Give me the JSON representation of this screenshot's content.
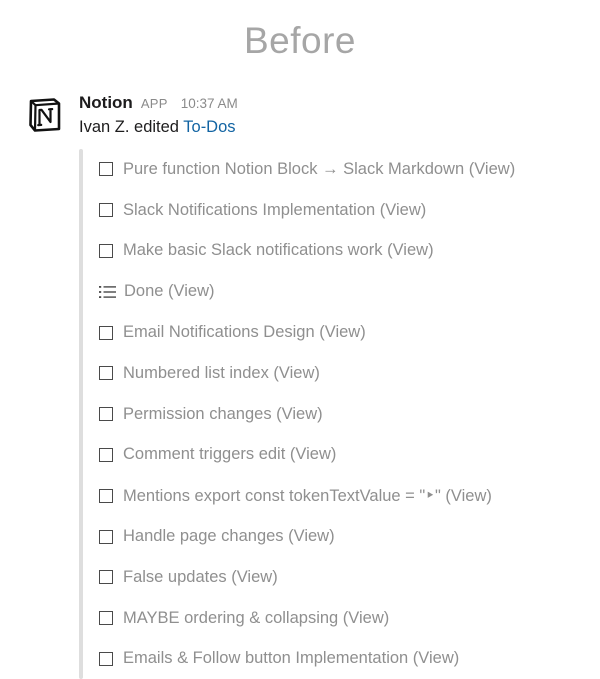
{
  "heading": "Before",
  "message": {
    "sender": "Notion",
    "badge": "APP",
    "time": "10:37 AM",
    "summary_prefix": "Ivan Z. edited ",
    "summary_link": "To-Dos"
  },
  "items": [
    {
      "icon": "checkbox-icon",
      "text": "Pure function Notion Block → Slack Markdown (View)"
    },
    {
      "icon": "checkbox-icon",
      "text": "Slack Notifications Implementation (View)"
    },
    {
      "icon": "checkbox-icon",
      "text": "Make basic Slack notifications work (View)"
    },
    {
      "icon": "list-icon",
      "text": "Done (View)"
    },
    {
      "icon": "checkbox-icon",
      "text": "Email Notifications Design (View)"
    },
    {
      "icon": "checkbox-icon",
      "text": "Numbered list index (View)"
    },
    {
      "icon": "checkbox-icon",
      "text": "Permission changes (View)"
    },
    {
      "icon": "checkbox-icon",
      "text": "Comment triggers edit (View)"
    },
    {
      "icon": "checkbox-icon",
      "text": "Mentions export const tokenTextValue = \"‣\" (View)"
    },
    {
      "icon": "checkbox-icon",
      "text": "Handle page changes (View)"
    },
    {
      "icon": "checkbox-icon",
      "text": "False updates (View)"
    },
    {
      "icon": "checkbox-icon",
      "text": "MAYBE ordering & collapsing (View)"
    },
    {
      "icon": "checkbox-icon",
      "text": "Emails & Follow button Implementation (View)"
    }
  ]
}
